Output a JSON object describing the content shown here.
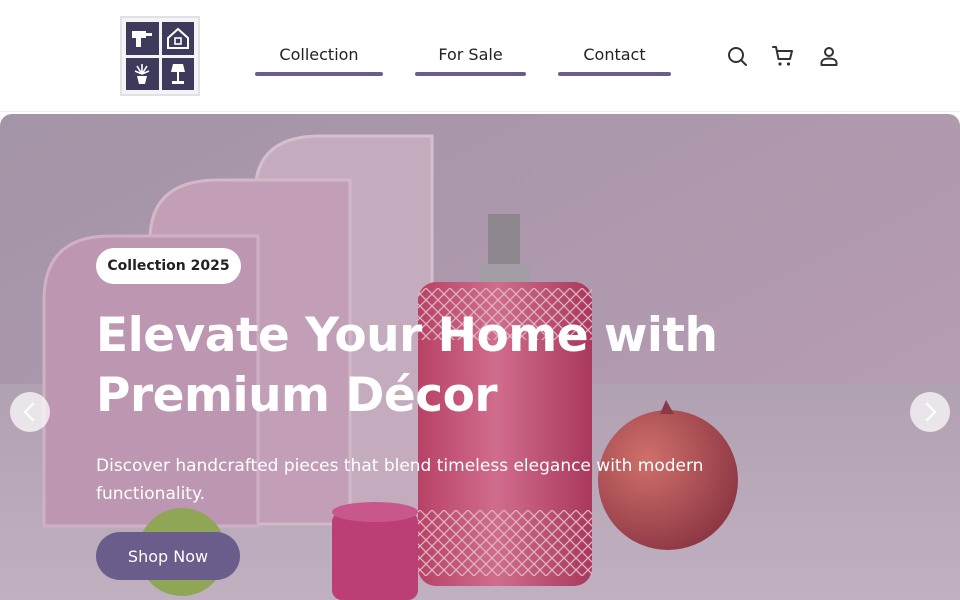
{
  "header": {
    "logo_icons": [
      "drill-icon",
      "house-icon",
      "plant-icon",
      "lamp-icon"
    ],
    "nav": [
      {
        "label": "Collection"
      },
      {
        "label": "For Sale"
      },
      {
        "label": "Contact"
      }
    ],
    "icons": [
      "search-icon",
      "cart-icon",
      "user-icon"
    ]
  },
  "hero": {
    "badge": "Collection 2025",
    "headline_line1": "Elevate Your Home with",
    "headline_line2": "Premium Décor",
    "subtext": "Discover handcrafted pieces that blend timeless elegance with modern functionality.",
    "cta_label": "Shop Now",
    "prev_icon": "chevron-left-icon",
    "next_icon": "chevron-right-icon"
  },
  "colors": {
    "accent": "#6a5d8c",
    "logo_tile": "#3d3a5c",
    "hero_tint": "#b08aa8",
    "text_light": "#ffffff"
  }
}
